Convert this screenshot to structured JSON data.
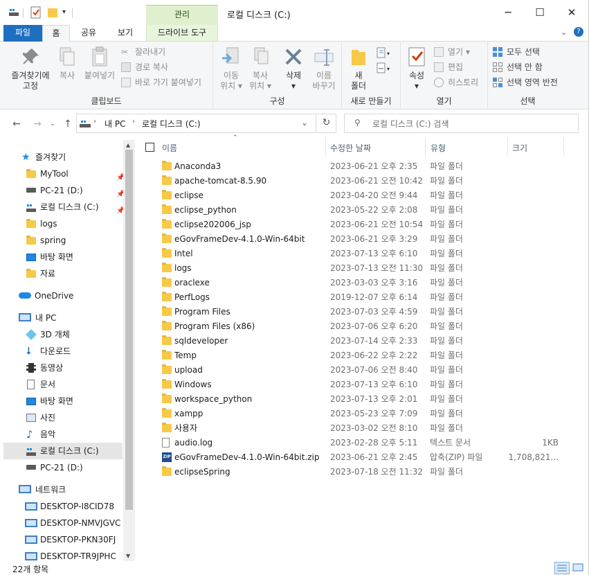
{
  "window": {
    "title": "로컬 디스크 (C:)",
    "context_tab": "관리",
    "controls": {
      "minimize": "─",
      "maximize": "☐",
      "close": "✕"
    }
  },
  "ribbon_tabs": {
    "file": "파일",
    "home": "홈",
    "share": "공유",
    "view": "보기",
    "drive_tools": "드라이브 도구"
  },
  "ribbon": {
    "clipboard": {
      "label": "클립보드",
      "pin_quick_access": [
        "즐겨찾기에",
        "고정"
      ],
      "copy": "복사",
      "paste": "붙여넣기",
      "cut": "잘라내기",
      "copy_path": "경로 복사",
      "paste_shortcut": "바로 가기 붙여넣기"
    },
    "organize": {
      "label": "구성",
      "move_to": [
        "이동",
        "위치"
      ],
      "copy_to": [
        "복사",
        "위치"
      ],
      "delete": "삭제",
      "rename": [
        "이름",
        "바꾸기"
      ]
    },
    "new": {
      "label": "새로 만들기",
      "new_folder": [
        "새",
        "폴더"
      ]
    },
    "open": {
      "label": "열기",
      "properties": "속성",
      "open": "열기",
      "edit": "편집",
      "history": "히스토리"
    },
    "select": {
      "label": "선택",
      "select_all": "모두 선택",
      "select_none": "선택 안 함",
      "invert": "선택 영역 반전"
    }
  },
  "address": {
    "crumbs": [
      "내 PC",
      "로컬 디스크 (C:)"
    ],
    "search_placeholder": "로컬 디스크 (C:) 검색"
  },
  "sidebar": {
    "quick_access": "즐겨찾기",
    "quick_items": [
      {
        "label": "MyTool",
        "icon": "folder-icon",
        "pinned": true
      },
      {
        "label": "PC-21 (D:)",
        "icon": "drive-icon",
        "pinned": true
      },
      {
        "label": "로컬 디스크 (C:)",
        "icon": "windows-drive-icon",
        "pinned": true
      },
      {
        "label": "logs",
        "icon": "folder-icon",
        "pinned": false
      },
      {
        "label": "spring",
        "icon": "folder-icon",
        "pinned": false
      },
      {
        "label": "바탕 화면",
        "icon": "desktop-icon",
        "pinned": false
      },
      {
        "label": "자료",
        "icon": "folder-icon",
        "pinned": false
      }
    ],
    "onedrive": "OneDrive",
    "this_pc": "내 PC",
    "pc_items": [
      {
        "label": "3D 개체",
        "icon": "cube-icon"
      },
      {
        "label": "다운로드",
        "icon": "download-icon"
      },
      {
        "label": "동영상",
        "icon": "video-icon"
      },
      {
        "label": "문서",
        "icon": "document-icon"
      },
      {
        "label": "바탕 화면",
        "icon": "desktop-icon"
      },
      {
        "label": "사진",
        "icon": "picture-icon"
      },
      {
        "label": "음악",
        "icon": "music-icon"
      },
      {
        "label": "로컬 디스크 (C:)",
        "icon": "windows-drive-icon"
      },
      {
        "label": "PC-21 (D:)",
        "icon": "drive-icon"
      }
    ],
    "network": "네트워크",
    "network_items": [
      "DESKTOP-I8CID78",
      "DESKTOP-NMVJGVC",
      "DESKTOP-PKN30FJ",
      "DESKTOP-TR9JPHC"
    ]
  },
  "columns": {
    "name": "이름",
    "modified": "수정한 날짜",
    "type": "유형",
    "size": "크기"
  },
  "files": [
    {
      "name": "Anaconda3",
      "date": "2023-06-21 오후 2:35",
      "type": "파일 폴더",
      "size": "",
      "icon": "folder-icon"
    },
    {
      "name": "apache-tomcat-8.5.90",
      "date": "2023-06-21 오전 10:42",
      "type": "파일 폴더",
      "size": "",
      "icon": "folder-icon"
    },
    {
      "name": "eclipse",
      "date": "2023-04-20 오전 9:44",
      "type": "파일 폴더",
      "size": "",
      "icon": "folder-icon"
    },
    {
      "name": "eclipse_python",
      "date": "2023-05-22 오후 2:08",
      "type": "파일 폴더",
      "size": "",
      "icon": "folder-icon"
    },
    {
      "name": "eclipse202006_jsp",
      "date": "2023-06-21 오전 10:54",
      "type": "파일 폴더",
      "size": "",
      "icon": "folder-icon"
    },
    {
      "name": "eGovFrameDev-4.1.0-Win-64bit",
      "date": "2023-06-21 오후 3:29",
      "type": "파일 폴더",
      "size": "",
      "icon": "folder-icon"
    },
    {
      "name": "Intel",
      "date": "2023-07-13 오후 6:10",
      "type": "파일 폴더",
      "size": "",
      "icon": "folder-icon"
    },
    {
      "name": "logs",
      "date": "2023-07-13 오전 11:30",
      "type": "파일 폴더",
      "size": "",
      "icon": "folder-icon"
    },
    {
      "name": "oraclexe",
      "date": "2023-03-03 오후 3:16",
      "type": "파일 폴더",
      "size": "",
      "icon": "folder-icon"
    },
    {
      "name": "PerfLogs",
      "date": "2019-12-07 오후 6:14",
      "type": "파일 폴더",
      "size": "",
      "icon": "folder-icon"
    },
    {
      "name": "Program Files",
      "date": "2023-07-03 오후 4:59",
      "type": "파일 폴더",
      "size": "",
      "icon": "folder-icon"
    },
    {
      "name": "Program Files (x86)",
      "date": "2023-07-06 오후 6:20",
      "type": "파일 폴더",
      "size": "",
      "icon": "folder-icon"
    },
    {
      "name": "sqldeveloper",
      "date": "2023-07-14 오후 2:33",
      "type": "파일 폴더",
      "size": "",
      "icon": "folder-icon"
    },
    {
      "name": "Temp",
      "date": "2023-06-22 오후 2:22",
      "type": "파일 폴더",
      "size": "",
      "icon": "folder-icon"
    },
    {
      "name": "upload",
      "date": "2023-07-06 오전 8:40",
      "type": "파일 폴더",
      "size": "",
      "icon": "folder-icon"
    },
    {
      "name": "Windows",
      "date": "2023-07-13 오후 6:10",
      "type": "파일 폴더",
      "size": "",
      "icon": "folder-icon"
    },
    {
      "name": "workspace_python",
      "date": "2023-07-13 오후 2:01",
      "type": "파일 폴더",
      "size": "",
      "icon": "folder-icon"
    },
    {
      "name": "xampp",
      "date": "2023-05-23 오후 7:09",
      "type": "파일 폴더",
      "size": "",
      "icon": "folder-icon"
    },
    {
      "name": "사용자",
      "date": "2023-03-02 오전 8:10",
      "type": "파일 폴더",
      "size": "",
      "icon": "folder-icon"
    },
    {
      "name": "audio.log",
      "date": "2023-02-28 오후 5:11",
      "type": "텍스트 문서",
      "size": "1KB",
      "icon": "text-file-icon"
    },
    {
      "name": "eGovFrameDev-4.1.0-Win-64bit.zip",
      "date": "2023-06-21 오후 2:45",
      "type": "압축(ZIP) 파일",
      "size": "1,708,821...",
      "icon": "zip-file-icon"
    },
    {
      "name": "eclipseSpring",
      "date": "2023-07-18 오전 11:32",
      "type": "파일 폴더",
      "size": "",
      "icon": "folder-icon"
    }
  ],
  "status": {
    "item_count": "22개 항목"
  },
  "colors": {
    "file_tab": "#1e6fbf",
    "context_tab": "#dff0cf",
    "folder": "#f7c948",
    "selected_nav": "#e5e5e5"
  }
}
